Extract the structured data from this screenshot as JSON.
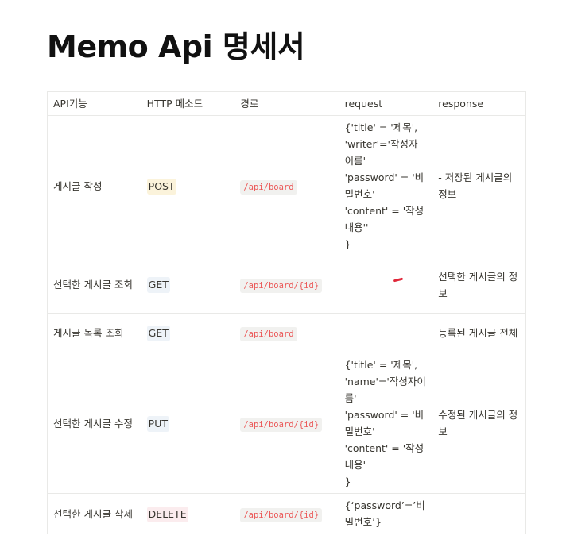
{
  "page": {
    "title": "Memo Api 명세서"
  },
  "colors": {
    "text": "#37352f",
    "title": "#111111",
    "border": "#e9e9e7",
    "code_bg": "#f1f1ef",
    "code_text": "#eb5757",
    "post_bg": "#fbf3db",
    "get_bg": "#eef3f8",
    "put_bg": "#eef3f8",
    "delete_bg": "#fbecee",
    "mark": "#e0283a"
  },
  "table": {
    "headers": [
      "API기능",
      "HTTP 메소드",
      "경로",
      "request",
      "response"
    ],
    "rows": [
      {
        "feature": "게시글 작성",
        "method": "POST",
        "path": "/api/board",
        "request": "{'title' = '제목',\n'writer'='작성자이름'\n'password' = '비밀번호'\n'content' = '작성 내용''\n}",
        "response": "- 저장된 게시글의 정보"
      },
      {
        "feature": "선택한 게시글 조회",
        "method": "GET",
        "path": "/api/board/{id}",
        "request": "",
        "response": "선택한 게시글의 정보"
      },
      {
        "feature": "게시글 목록 조회",
        "method": "GET",
        "path": "/api/board",
        "request": "",
        "response": "등록된 게시글 전체"
      },
      {
        "feature": "선택한 게시글 수정",
        "method": "PUT",
        "path": "/api/board/{id}",
        "request": "{'title' = '제목',\n'name'='작성자이름'\n'password' = '비밀번호'\n'content' = '작성 내용'\n}",
        "response": "수정된 게시글의 정보"
      },
      {
        "feature": "선택한 게시글 삭제",
        "method": "DELETE",
        "path": "/api/board/{id}",
        "request": "{‘password’=’비밀번호’}",
        "response": ""
      }
    ]
  }
}
